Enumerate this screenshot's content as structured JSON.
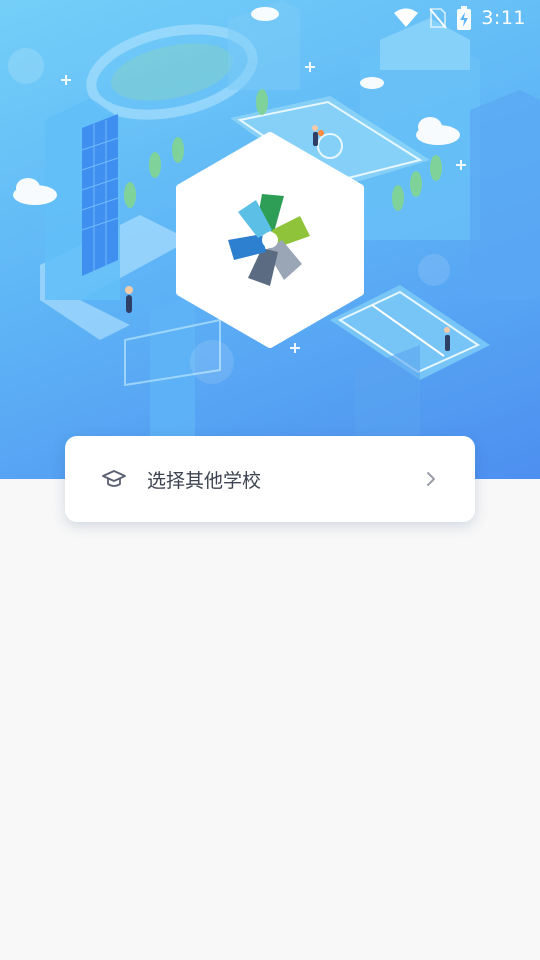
{
  "status_bar": {
    "time": "3:11",
    "icons": [
      "wifi-icon",
      "no-sim-icon",
      "battery-charging-icon"
    ]
  },
  "hero": {
    "illustration": "isometric-campus-illustration",
    "logo": "school-star-logo"
  },
  "school_selector": {
    "label": "选择其他学校",
    "icon": "graduation-cap-icon",
    "trailing_icon": "chevron-right-icon"
  },
  "colors": {
    "hero_top": "#74cff8",
    "hero_bottom": "#4d8ff0",
    "page_background": "#f8f8f8",
    "card_background": "#ffffff",
    "text": "#3d4350"
  }
}
